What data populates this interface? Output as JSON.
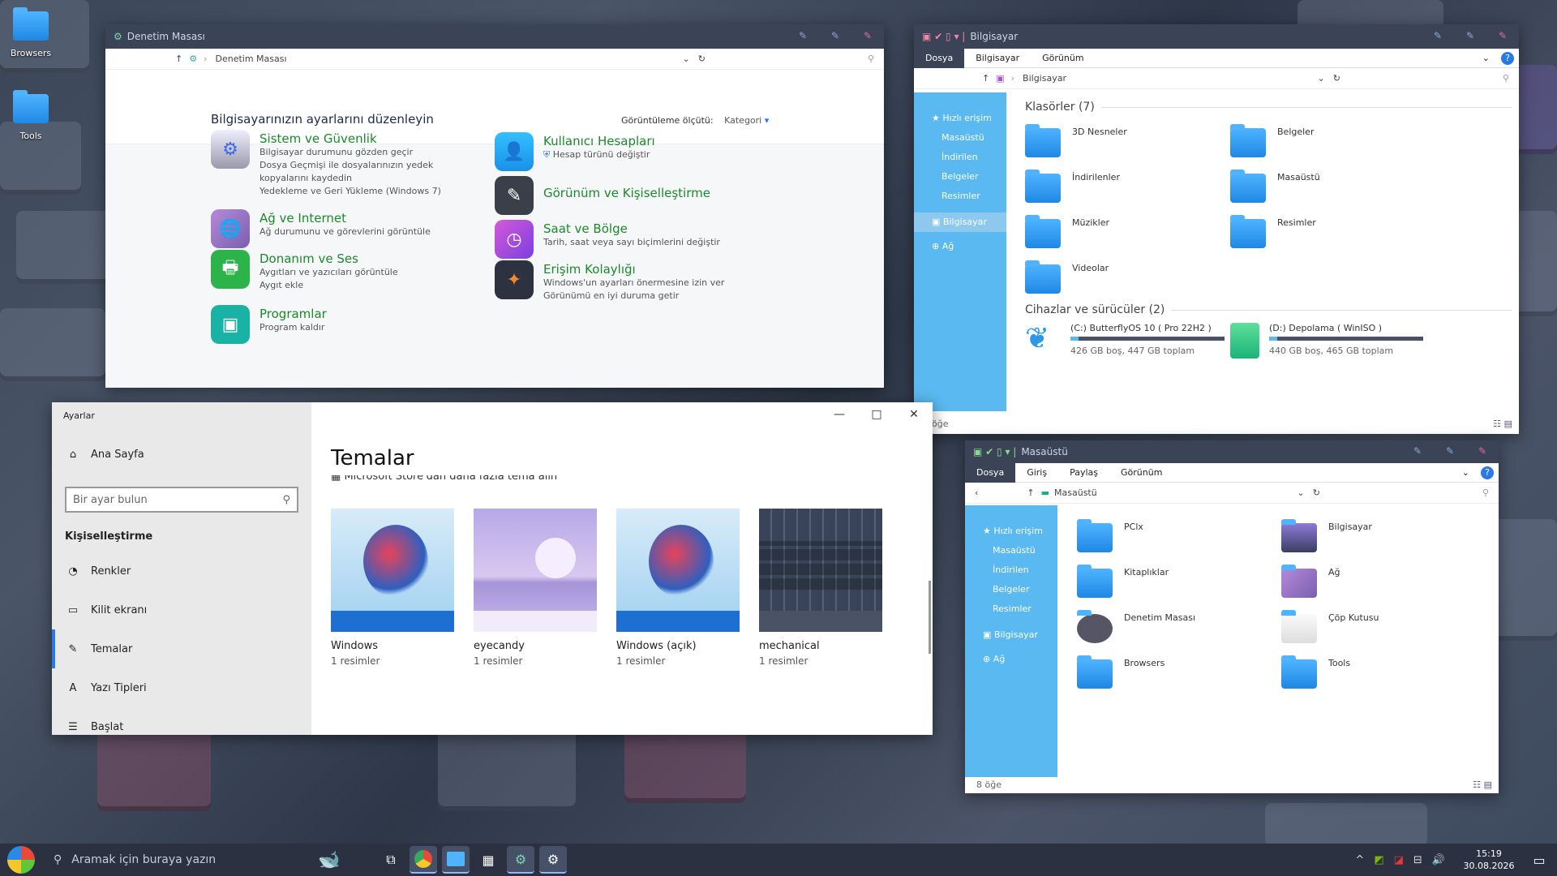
{
  "desktop": {
    "icons": [
      {
        "label": "Browsers"
      },
      {
        "label": "Tools"
      }
    ]
  },
  "control_panel": {
    "title": "Denetim Masası",
    "address": "Denetim Masası",
    "heading": "Bilgisayarınızın ayarlarını düzenleyin",
    "view_by_label": "Görüntüleme ölçütü:",
    "view_by_value": "Kategori",
    "categories": [
      {
        "title": "Sistem ve Güvenlik",
        "lines": [
          "Bilgisayar durumunu gözden geçir",
          "Dosya Geçmişi ile dosyalarınızın yedek kopyalarını kaydedin",
          "Yedekleme ve Geri Yükleme (Windows 7)"
        ]
      },
      {
        "title": "Ağ ve Internet",
        "lines": [
          "Ağ durumunu ve görevlerini görüntüle"
        ]
      },
      {
        "title": "Donanım ve Ses",
        "lines": [
          "Aygıtları ve yazıcıları görüntüle",
          "Aygıt ekle"
        ]
      },
      {
        "title": "Programlar",
        "lines": [
          "Program kaldır"
        ]
      },
      {
        "title": "Kullanıcı Hesapları",
        "lines": [
          "Hesap türünü değiştir"
        ]
      },
      {
        "title": "Görünüm ve Kişiselleştirme",
        "lines": []
      },
      {
        "title": "Saat ve Bölge",
        "lines": [
          "Tarih, saat veya sayı biçimlerini değiştir"
        ]
      },
      {
        "title": "Erişim Kolaylığı",
        "lines": [
          "Windows'un ayarları önermesine izin ver",
          "Görünümü en iyi duruma getir"
        ]
      }
    ]
  },
  "explorer1": {
    "title": "Bilgisayar",
    "tabs": [
      "Dosya",
      "Bilgisayar",
      "Görünüm"
    ],
    "address": "Bilgisayar",
    "nav": [
      "Hızlı erişim",
      "Masaüstü",
      "İndirilen",
      "Belgeler",
      "Resimler",
      "Bilgisayar",
      "Ağ"
    ],
    "folders_header": "Klasörler (7)",
    "folders": [
      "3D Nesneler",
      "Belgeler",
      "İndirilenler",
      "Masaüstü",
      "Müzikler",
      "Resimler",
      "Videolar"
    ],
    "drives_header": "Cihazlar ve sürücüler (2)",
    "drives": [
      {
        "name": "(C:) ButterflyOS 10 ( Pro 22H2 )",
        "info": "426 GB boş, 447 GB toplam",
        "used": 0.05
      },
      {
        "name": "(D:) Depolama ( WinISO )",
        "info": "440 GB boş, 465 GB toplam",
        "used": 0.05
      }
    ],
    "status": "öğe"
  },
  "explorer2": {
    "title": "Masaüstü",
    "tabs": [
      "Dosya",
      "Giriş",
      "Paylaş",
      "Görünüm"
    ],
    "address": "Masaüstü",
    "nav": [
      "Hızlı erişim",
      "Masaüstü",
      "İndirilen",
      "Belgeler",
      "Resimler",
      "Bilgisayar",
      "Ağ"
    ],
    "items": [
      "PClx",
      "Bilgisayar",
      "Kitaplıklar",
      "Ağ",
      "Denetim Masası",
      "Çöp Kutusu",
      "Browsers",
      "Tools"
    ],
    "status": "8 öğe"
  },
  "settings": {
    "title": "Ayarlar",
    "home": "Ana Sayfa",
    "search_placeholder": "Bir ayar bulun",
    "section": "Kişiselleştirme",
    "nav": [
      "Renkler",
      "Kilit ekranı",
      "Temalar",
      "Yazı Tipleri",
      "Başlat"
    ],
    "page_title": "Temalar",
    "store_link": "Microsoft Store'dan daha fazla tema alın",
    "themes": [
      {
        "name": "Windows",
        "count": "1 resimler"
      },
      {
        "name": "eyecandy",
        "count": "1 resimler"
      },
      {
        "name": "Windows (açık)",
        "count": "1 resimler"
      },
      {
        "name": "mechanical",
        "count": "1 resimler"
      }
    ]
  },
  "taskbar": {
    "search_placeholder": "Aramak için buraya yazın",
    "time": "15:19",
    "date": "30.08.2026"
  }
}
